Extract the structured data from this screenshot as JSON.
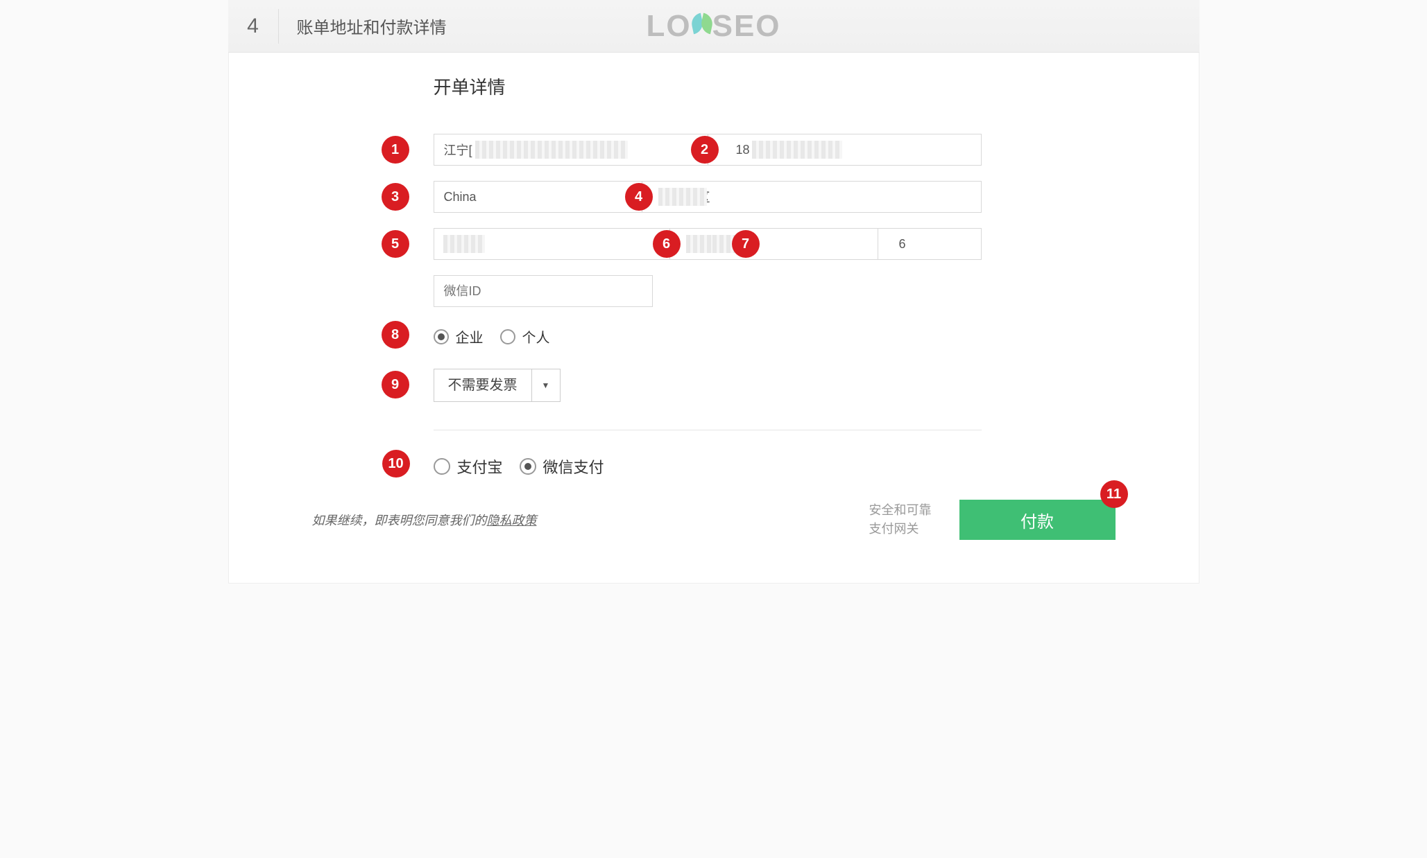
{
  "header": {
    "step_number": "4",
    "step_title": "账单地址和付款详情",
    "logo_part1": "LO",
    "logo_part2": "SEO"
  },
  "section_title": "开单详情",
  "markers": {
    "m1": "1",
    "m2": "2",
    "m3": "3",
    "m4": "4",
    "m5": "5",
    "m6": "6",
    "m7": "7",
    "m8": "8",
    "m9": "9",
    "m10": "10",
    "m11": "11"
  },
  "fields": {
    "address1_value": "江宁[",
    "address2_value": "18",
    "country_value": "China",
    "district_value": "区",
    "state_value": "",
    "city_value": "",
    "zip_value": "6",
    "wechat_placeholder": "微信ID"
  },
  "entity_type": {
    "company": "企业",
    "personal": "个人"
  },
  "invoice": {
    "selected": "不需要发票"
  },
  "payment": {
    "alipay": "支付宝",
    "wechat": "微信支付"
  },
  "footer": {
    "privacy_prefix": "如果继续，即表明您同意我们的",
    "privacy_link": "隐私政策",
    "secure_line1": "安全和可靠",
    "secure_line2": "支付网关",
    "pay_button": "付款"
  }
}
